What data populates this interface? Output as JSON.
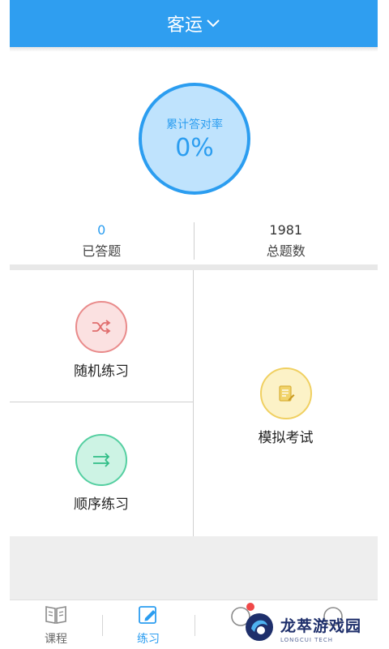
{
  "header": {
    "title": "客运",
    "dropdown_icon": "chevron-down-icon",
    "color": "#2f9ef0"
  },
  "summary": {
    "rate_label": "累计答对率",
    "rate_value": "0%",
    "answered_count": "0",
    "answered_label": "已答题",
    "total_count": "1981",
    "total_label": "总题数"
  },
  "practice": {
    "random": {
      "label": "随机练习",
      "icon": "shuffle-icon",
      "color": "#e98b8b"
    },
    "sequential": {
      "label": "顺序练习",
      "icon": "arrows-right-icon",
      "color": "#55cfa1"
    },
    "mock_exam": {
      "label": "模拟考试",
      "icon": "exam-paper-icon",
      "color": "#f0d061"
    }
  },
  "tabbar": {
    "tabs": [
      {
        "label": "课程",
        "icon": "book-icon",
        "active": false
      },
      {
        "label": "练习",
        "icon": "edit-icon",
        "active": true
      },
      {
        "label": "",
        "icon": "message-icon",
        "active": false
      },
      {
        "label": "",
        "icon": "profile-icon",
        "active": false
      }
    ]
  },
  "watermark": {
    "text": "龙萃游戏园",
    "subtext": "LONGCUI TECH"
  }
}
